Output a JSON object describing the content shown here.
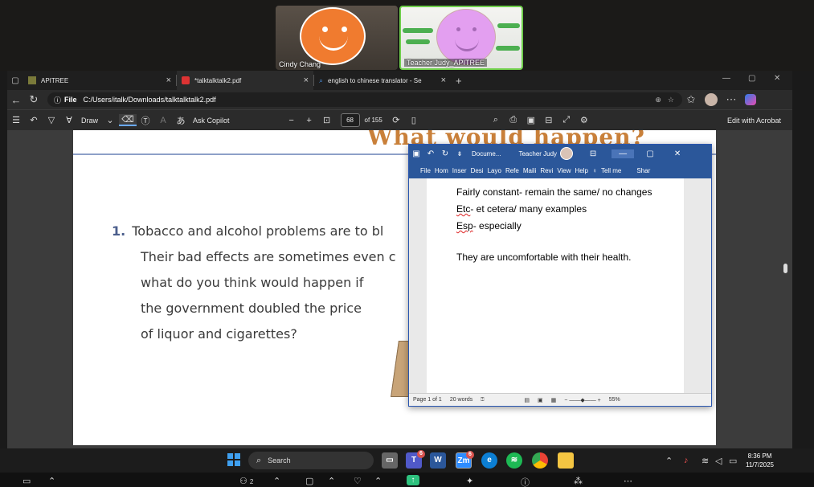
{
  "zoom": {
    "participants": [
      {
        "name": "Cindy Chang"
      },
      {
        "name": "Teacher Judy_APITREE"
      }
    ],
    "bottom": {
      "participants_count": "2"
    }
  },
  "browser": {
    "tabs": [
      {
        "label": "APITREE"
      },
      {
        "label": "*talktalktalk2.pdf"
      },
      {
        "label": "english to chinese translator - Se"
      }
    ],
    "address": {
      "scheme_label": "File",
      "url": "C:/Users/italk/Downloads/talktalktalk2.pdf"
    },
    "pdf_toolbar": {
      "draw_label": "Draw",
      "copilot_label": "Ask Copilot",
      "page_current": "68",
      "page_total": "of 155",
      "edit_label": "Edit with Acrobat"
    }
  },
  "pdf": {
    "title": "What would happen?",
    "question_number": "1.",
    "question_lines": [
      "Tobacco and alcohol problems are to bl",
      "Their bad effects are sometimes even c",
      "what do you think would happen if",
      "the government doubled the price",
      "of liquor and cigarettes?"
    ]
  },
  "word": {
    "doc_name": "Docume...",
    "user_name": "Teacher Judy",
    "ribbon": [
      "File",
      "Hom",
      "Inser",
      "Desi",
      "Layo",
      "Refe",
      "Maili",
      "Revi",
      "View",
      "Help",
      "Tell me",
      "Shar"
    ],
    "lines": [
      {
        "pre": "",
        "sq": "",
        "post": "Fairly constant- remain the same/ no changes"
      },
      {
        "pre": "",
        "sq": "Etc",
        "post": "- et cetera/ many examples"
      },
      {
        "pre": "",
        "sq": "Esp",
        "post": "- especially"
      },
      {
        "pre": "",
        "sq": "",
        "post": "They are uncomfortable with their health."
      }
    ],
    "status": {
      "page": "Page 1 of 1",
      "words": "20 words",
      "zoom": "55%"
    }
  },
  "taskbar": {
    "search_placeholder": "Search",
    "teams_badge": "6",
    "zoom_badge": "6",
    "zoom_label": "Zm",
    "word_label": "W",
    "time": "8:36 PM",
    "date": "11/7/2025"
  }
}
